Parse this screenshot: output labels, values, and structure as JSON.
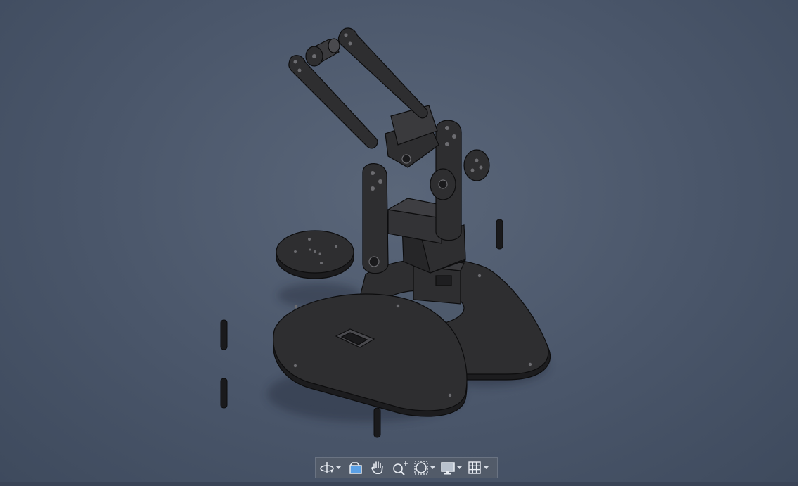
{
  "window": {
    "title": ""
  },
  "viewport": {
    "background_color": "#4a566a",
    "model": "robotic-arm-assembly-exploded-view"
  },
  "navigation_toolbar": {
    "items": [
      {
        "name": "orbit-icon",
        "has_dropdown": true
      },
      {
        "name": "look-at-icon",
        "has_dropdown": false
      },
      {
        "name": "pan-hand-icon",
        "has_dropdown": false
      },
      {
        "name": "zoom-icon",
        "has_dropdown": false
      },
      {
        "name": "fit-window-icon",
        "has_dropdown": true
      },
      {
        "name": "display-settings-icon",
        "has_dropdown": true
      },
      {
        "name": "grid-icon",
        "has_dropdown": true
      }
    ]
  },
  "colors": {
    "part_fill": "#2e2e30",
    "part_edge": "#0d0d0e",
    "toolbar_bg": "#525b69",
    "icon_color": "#e8ecf2",
    "icon_accent": "#5aa0e6"
  }
}
